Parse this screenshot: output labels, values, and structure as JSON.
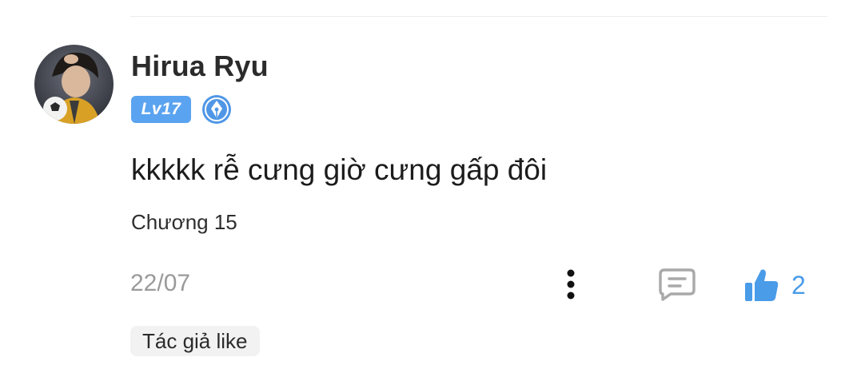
{
  "comment": {
    "username": "Hirua Ryu",
    "level_badge": "Lv17",
    "text": "kkkkk rễ cưng giờ cưng gấp đôi",
    "chapter": "Chương 15",
    "date": "22/07",
    "like_count": "2",
    "author_like_tag": "Tác giả like"
  },
  "icons": {
    "avatar": "user-avatar-photo",
    "writer_badge": "pen-nib-badge-icon",
    "more": "vertical-dots-icon",
    "reply": "chat-bubble-icon",
    "like": "thumbs-up-icon"
  },
  "colors": {
    "accent": "#4a9be8",
    "level_badge_bg": "#5aa3f0",
    "tag_bg": "#f2f2f2",
    "muted_text": "#9a9a9a"
  }
}
